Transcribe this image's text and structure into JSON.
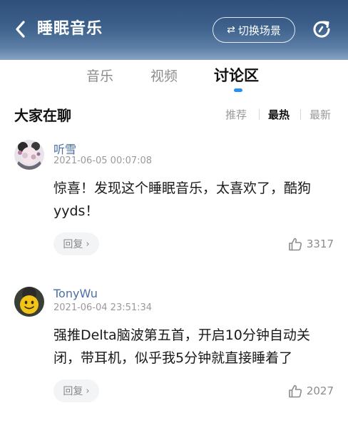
{
  "header": {
    "title": "睡眠音乐",
    "switch_label": "切换场景",
    "switch_icon": "⇄",
    "bg_color": "#3d618c"
  },
  "tabs": [
    {
      "label": "音乐",
      "active": false
    },
    {
      "label": "视频",
      "active": false
    },
    {
      "label": "讨论区",
      "active": true
    }
  ],
  "section": {
    "title": "大家在聊",
    "sort_options": [
      {
        "label": "推荐",
        "active": false
      },
      {
        "label": "最热",
        "active": true
      },
      {
        "label": "最新",
        "active": false
      }
    ]
  },
  "comments": [
    {
      "username": "听雪",
      "date": "2021-06-05 00:07:08",
      "text": "惊喜！发现这个睡眠音乐，太喜欢了，酷狗yyds！",
      "reply_label": "回复",
      "likes": "3317"
    },
    {
      "username": "TonyWu",
      "date": "2021-06-04 23:51:34",
      "text": "强推Delta脑波第五首，开启10分钟自动关闭，带耳机，似乎我5分钟就直接睡着了",
      "reply_label": "回复",
      "likes": "2027"
    }
  ],
  "colors": {
    "accent": "#2b8ff0",
    "username": "#4a6fa5"
  }
}
